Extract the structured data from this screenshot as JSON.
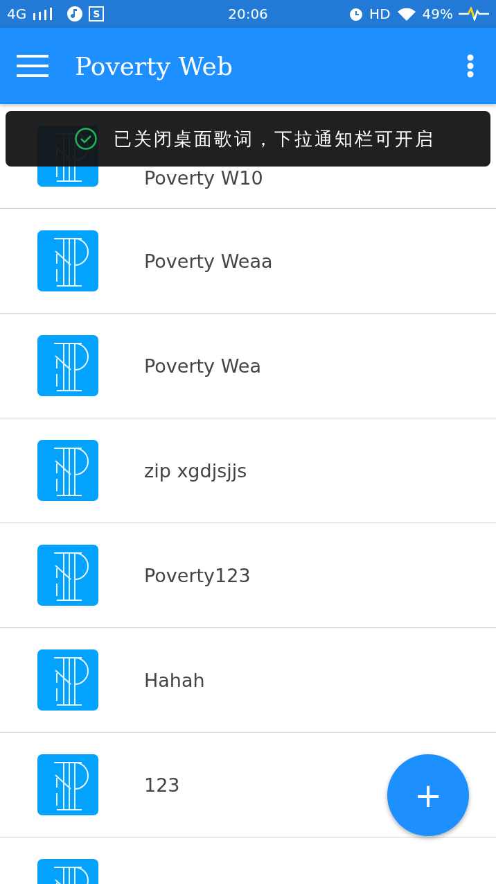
{
  "status_bar": {
    "network": "4G",
    "app_badge": "S",
    "time": "20:06",
    "hd": "HD",
    "battery": "49%"
  },
  "app_bar": {
    "title": "Poverty Web"
  },
  "toast": {
    "message": "已关闭桌面歌词，下拉通知栏可开启"
  },
  "items": [
    {
      "kind": "full",
      "title": "Poverty W10"
    },
    {
      "kind": "full",
      "title": "Poverty Weaa"
    },
    {
      "kind": "full",
      "title": "Poverty Wea"
    },
    {
      "kind": "full",
      "title": "zip xgdjsjjs"
    },
    {
      "kind": "full",
      "title": "Poverty123"
    },
    {
      "kind": "full",
      "title": "Hahah"
    },
    {
      "kind": "full",
      "title": "123"
    },
    {
      "kind": "partial"
    }
  ],
  "fab": {
    "label": "+"
  }
}
